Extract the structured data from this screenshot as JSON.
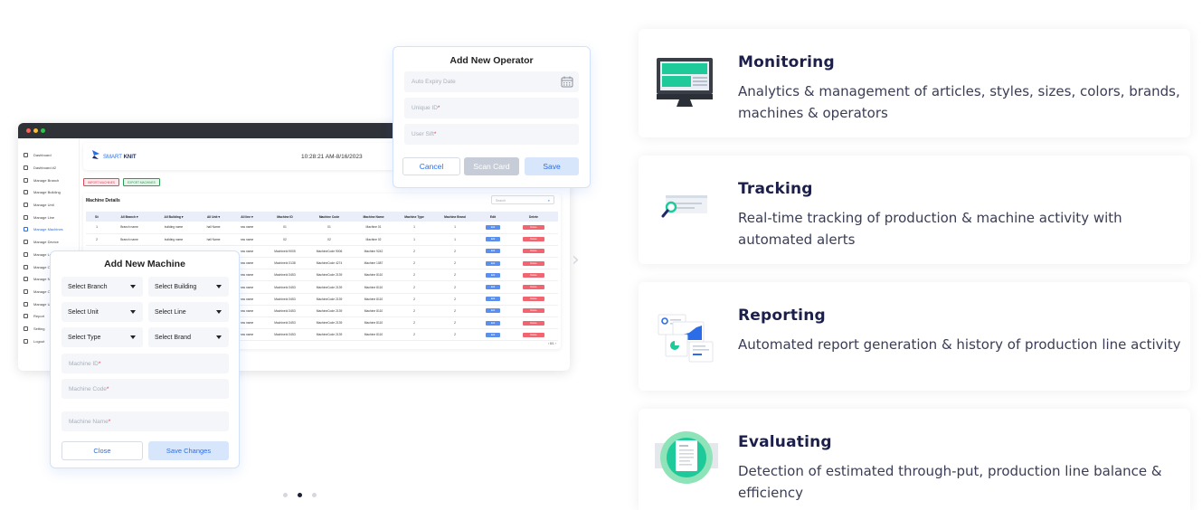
{
  "mockup": {
    "sidebar": [
      {
        "label": "Dashboard",
        "active": false
      },
      {
        "label": "Dashboard #2",
        "active": false
      },
      {
        "label": "Manage Branch",
        "active": false
      },
      {
        "label": "Manage Building",
        "active": false
      },
      {
        "label": "Manage Unit",
        "active": false
      },
      {
        "label": "Manage Line",
        "active": false
      },
      {
        "label": "Manage Machines",
        "active": true
      },
      {
        "label": "Manage Device",
        "active": false
      },
      {
        "label": "Manage Lr",
        "active": false
      },
      {
        "label": "Manage O",
        "active": false
      },
      {
        "label": "Manage N",
        "active": false
      },
      {
        "label": "Manage O",
        "active": false
      },
      {
        "label": "Manage U",
        "active": false
      },
      {
        "label": "Report",
        "active": false
      },
      {
        "label": "Setting",
        "active": false
      },
      {
        "label": "Logout",
        "active": false
      }
    ],
    "header": {
      "logo_smart": "SMART",
      "logo_knit": "KNIT",
      "clock": "10:28:21 AM-8/16/2023"
    },
    "buttons": {
      "import": "IMPORT MACHINES",
      "export": "EXPORT MACHINES"
    },
    "machine_details": {
      "title": "Machine Details",
      "search_placeholder": "Search",
      "columns": [
        "S#",
        "All Branch ▾",
        "All Building ▾",
        "All Unit ▾",
        "All line ▾",
        "Machine ID",
        "Machine Code",
        "Machine Name",
        "Machine Type",
        "Machine Brand",
        "Edit",
        "Delete"
      ],
      "rows": [
        [
          "1",
          "Branch name",
          "building name",
          "hall Name",
          "row name",
          "01",
          "01",
          "Machine 01",
          "1",
          "1"
        ],
        [
          "2",
          "Branch name",
          "building name",
          "hall Name",
          "row name",
          "02",
          "02",
          "Machine 02",
          "1",
          "1"
        ],
        [
          "",
          "",
          "",
          "",
          "row name",
          "MachineId 9005",
          "MachineCode 9006",
          "Machine 9242",
          "2",
          "2"
        ],
        [
          "",
          "",
          "",
          "",
          "row name",
          "MachineId 3138",
          "MachineCode 4274",
          "Machine 1087",
          "2",
          "2"
        ],
        [
          "",
          "",
          "",
          "",
          "row name",
          "MachineId 3453",
          "MachineCode 2139",
          "Machine 8110",
          "2",
          "2"
        ],
        [
          "",
          "",
          "",
          "",
          "row name",
          "MachineId 3453",
          "MachineCode 2139",
          "Machine 8110",
          "2",
          "2"
        ],
        [
          "",
          "",
          "",
          "",
          "row name",
          "MachineId 3453",
          "MachineCode 2139",
          "Machine 8110",
          "2",
          "2"
        ],
        [
          "",
          "",
          "",
          "",
          "row name",
          "MachineId 3453",
          "MachineCode 2139",
          "Machine 8110",
          "2",
          "2"
        ],
        [
          "",
          "",
          "",
          "",
          "row name",
          "MachineId 3453",
          "MachineCode 2139",
          "Machine 8110",
          "2",
          "2"
        ],
        [
          "",
          "",
          "",
          "",
          "row name",
          "MachineId 3453",
          "MachineCode 2139",
          "Machine 8110",
          "2",
          "2"
        ]
      ],
      "edit_label": "Edit",
      "delete_label": "Delete",
      "pager": "‹  8/1  ›"
    },
    "operator_modal": {
      "title": "Add New Operator",
      "expiry_placeholder": "Auto Expiry Date",
      "unique_id_placeholder": "Unique ID",
      "shift_placeholder": "User Sift",
      "required_mark": "*",
      "cancel": "Cancel",
      "scan": "Scan Card",
      "save": "Save"
    },
    "machine_modal": {
      "title": "Add New Machine",
      "selects": [
        "Select Branch",
        "Select Building",
        "Select Unit",
        "Select Line",
        "Select Type",
        "Select Brand"
      ],
      "machine_id_placeholder": "Machine ID",
      "machine_code_placeholder": "Machine Code",
      "machine_name_placeholder": "Machine Name",
      "required_mark": "*",
      "close": "Close",
      "save_changes": "Save Changes"
    },
    "next_arrow": "›",
    "carousel": {
      "count": 3,
      "active_index": 1
    }
  },
  "features": [
    {
      "title": "Monitoring",
      "description": "Analytics & management of articles, styles, sizes, colors, brands, machines & operators",
      "icon": "monitor-icon"
    },
    {
      "title": "Tracking",
      "description": "Real-time tracking of production & machine activity with automated alerts",
      "icon": "tracking-search-icon"
    },
    {
      "title": "Reporting",
      "description": "Automated report generation & history of production line activity",
      "icon": "report-charts-icon"
    },
    {
      "title": "Evaluating",
      "description": "Detection of estimated through-put, production line balance & efficiency",
      "icon": "evaluation-document-icon"
    }
  ],
  "colors": {
    "accent": "#2b6de8",
    "title": "#1c1f4a",
    "green": "#1ec99a",
    "red": "#f0656f"
  }
}
